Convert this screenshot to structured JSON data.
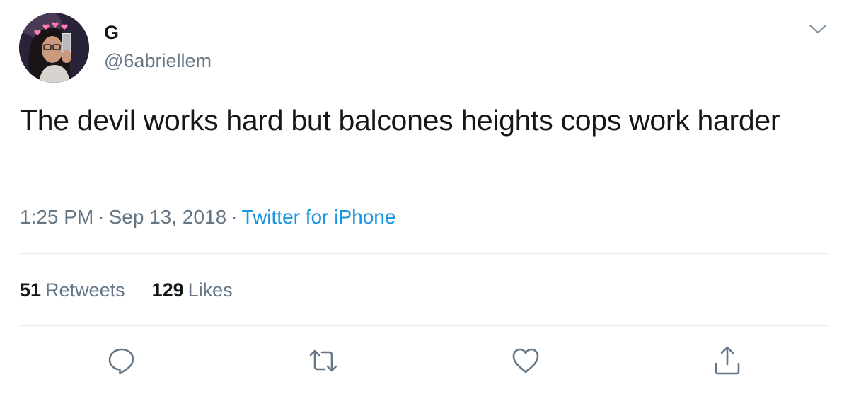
{
  "user": {
    "display_name": "G",
    "handle": "@6abriellem"
  },
  "tweet": {
    "text": "The devil works hard but balcones heights cops work harder",
    "time": "1:25 PM",
    "separator": "·",
    "date": "Sep 13, 2018",
    "source": "Twitter for iPhone"
  },
  "stats": {
    "retweets_count": "51",
    "retweets_label": "Retweets",
    "likes_count": "129",
    "likes_label": "Likes"
  },
  "icons": {
    "menu": "chevron-down-icon",
    "reply": "reply-icon",
    "retweet": "retweet-icon",
    "like": "heart-icon",
    "share": "share-icon"
  },
  "colors": {
    "text": "#14171a",
    "secondary": "#657786",
    "link": "#1b95e0",
    "divider": "#e6ecf0"
  }
}
